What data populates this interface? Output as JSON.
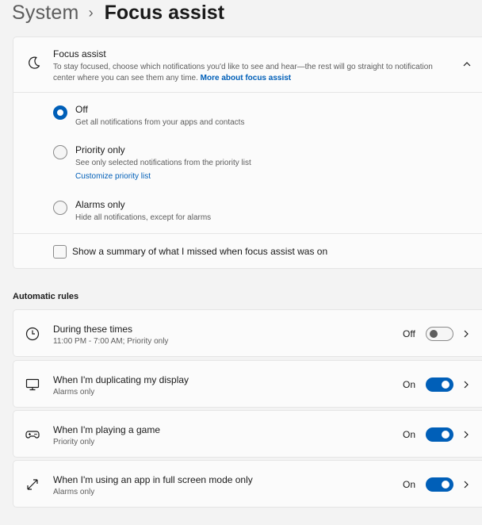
{
  "breadcrumb": {
    "parent": "System",
    "separator": "›",
    "current": "Focus assist"
  },
  "focus_assist": {
    "title": "Focus assist",
    "description": "To stay focused, choose which notifications you'd like to see and hear—the rest will go straight to notification center where you can see them any time.",
    "link": "More about focus assist",
    "options": [
      {
        "label": "Off",
        "sub": "Get all notifications from your apps and contacts",
        "selected": true
      },
      {
        "label": "Priority only",
        "sub": "See only selected notifications from the priority list",
        "link": "Customize priority list",
        "selected": false
      },
      {
        "label": "Alarms only",
        "sub": "Hide all notifications, except for alarms",
        "selected": false
      }
    ],
    "summary_label": "Show a summary of what I missed when focus assist was on",
    "summary_checked": false
  },
  "automatic_rules": {
    "title": "Automatic rules",
    "rules": [
      {
        "icon": "clock-icon",
        "title": "During these times",
        "sub": "11:00 PM - 7:00 AM; Priority only",
        "state": "Off",
        "on": false
      },
      {
        "icon": "monitor-icon",
        "title": "When I'm duplicating my display",
        "sub": "Alarms only",
        "state": "On",
        "on": true
      },
      {
        "icon": "gamepad-icon",
        "title": "When I'm playing a game",
        "sub": "Priority only",
        "state": "On",
        "on": true
      },
      {
        "icon": "fullscreen-icon",
        "title": "When I'm using an app in full screen mode only",
        "sub": "Alarms only",
        "state": "On",
        "on": true
      }
    ]
  },
  "colors": {
    "accent": "#005fb8",
    "background": "#f3f3f3",
    "card": "#fbfbfb"
  }
}
